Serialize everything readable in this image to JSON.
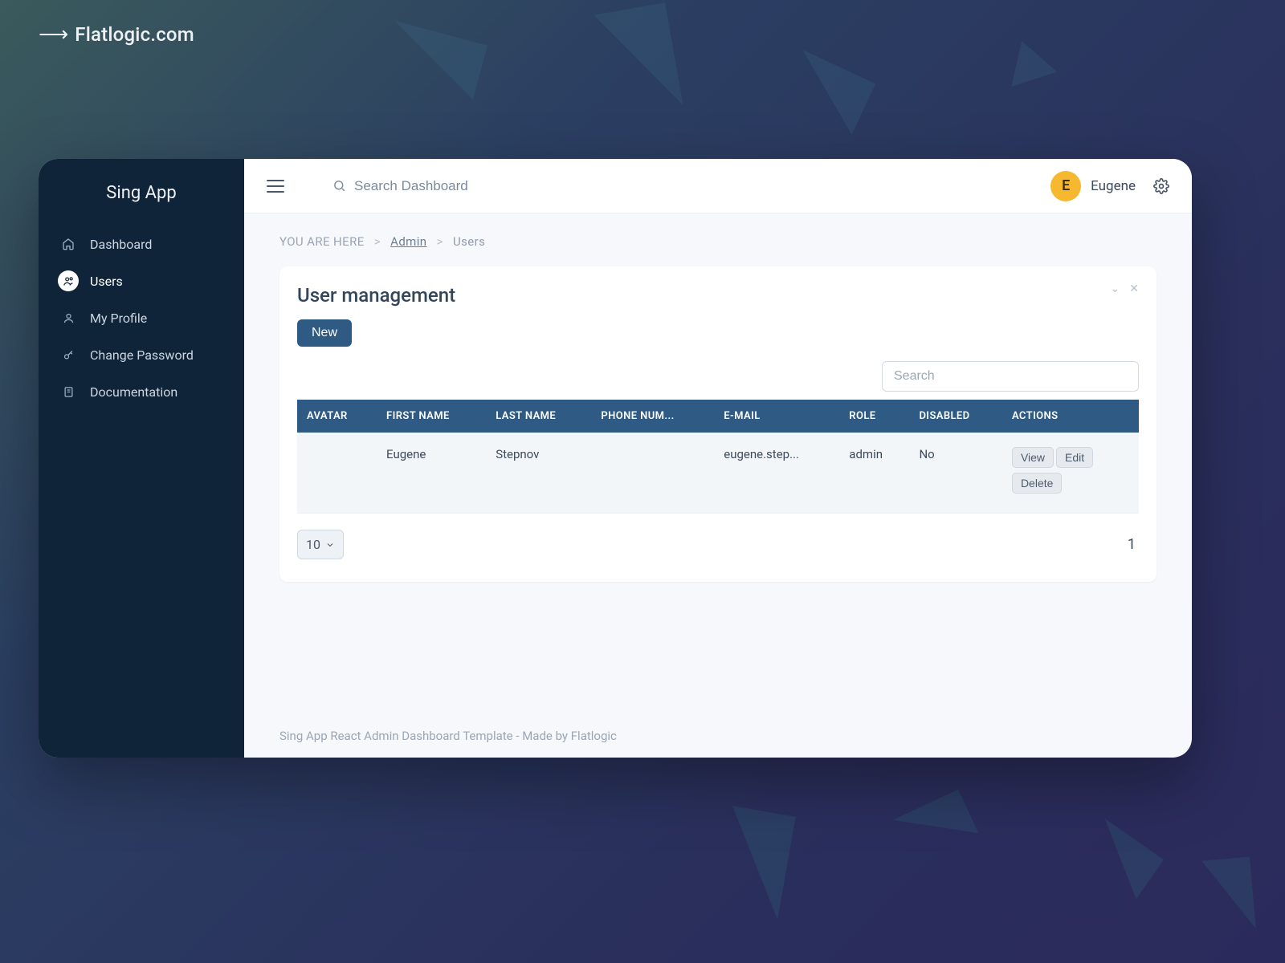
{
  "brand": {
    "arrow": "⟶",
    "label": "Flatlogic.com"
  },
  "sidebar": {
    "logo": "Sing App",
    "items": [
      {
        "label": "Dashboard",
        "icon": "home-icon"
      },
      {
        "label": "Users",
        "icon": "users-icon",
        "active": true
      },
      {
        "label": "My Profile",
        "icon": "profile-icon"
      },
      {
        "label": "Change Password",
        "icon": "key-icon"
      },
      {
        "label": "Documentation",
        "icon": "doc-icon"
      }
    ]
  },
  "topbar": {
    "search_placeholder": "Search Dashboard",
    "user_initial": "E",
    "user_name": "Eugene"
  },
  "breadcrumb": {
    "prefix": "YOU ARE HERE",
    "link": "Admin",
    "current": "Users",
    "sep": ">"
  },
  "panel": {
    "title": "User management",
    "new_label": "New",
    "table_search_placeholder": "Search",
    "columns": [
      "AVATAR",
      "FIRST NAME",
      "LAST NAME",
      "PHONE NUM...",
      "E-MAIL",
      "ROLE",
      "DISABLED",
      "ACTIONS"
    ],
    "rows": [
      {
        "avatar": "",
        "first_name": "Eugene",
        "last_name": "Stepnov",
        "phone": "",
        "email": "eugene.step...",
        "role": "admin",
        "disabled": "No"
      }
    ],
    "actions": {
      "view": "View",
      "edit": "Edit",
      "delete": "Delete"
    },
    "page_size": "10",
    "page_num": "1"
  },
  "footer": "Sing App React Admin Dashboard Template - Made by Flatlogic"
}
